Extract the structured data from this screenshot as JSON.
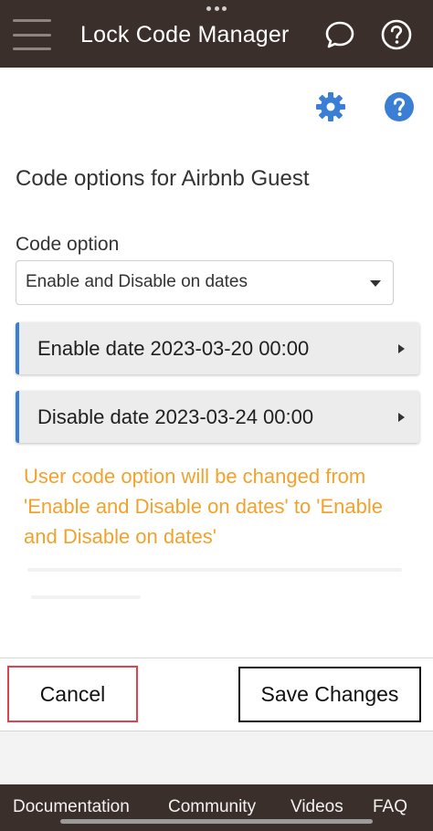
{
  "header": {
    "title": "Lock Code Manager",
    "menu_icon": "hamburger-menu-icon",
    "chat_icon": "chat-bubble-icon",
    "help_icon": "question-circle-icon"
  },
  "toolbar": {
    "settings_icon": "gear-icon",
    "help_icon": "question-circle-icon"
  },
  "main": {
    "title": "Code options for Airbnb Guest",
    "code_option": {
      "label": "Code option",
      "value": "Enable and Disable on dates"
    },
    "enable_date": "Enable date 2023-03-20 00:00",
    "disable_date": "Disable date 2023-03-24 00:00",
    "warning": "User code option will be changed from 'Enable and Disable on dates' to 'Enable and Disable on dates'"
  },
  "actions": {
    "cancel_label": "Cancel",
    "save_label": "Save Changes"
  },
  "footer": {
    "links": [
      "Documentation",
      "Community",
      "Videos",
      "FAQ"
    ]
  },
  "colors": {
    "topbar": "#3a2f2a",
    "accent_blue": "#3b7ed6",
    "warning": "#f2a22c",
    "cancel_border": "#e0434d"
  }
}
